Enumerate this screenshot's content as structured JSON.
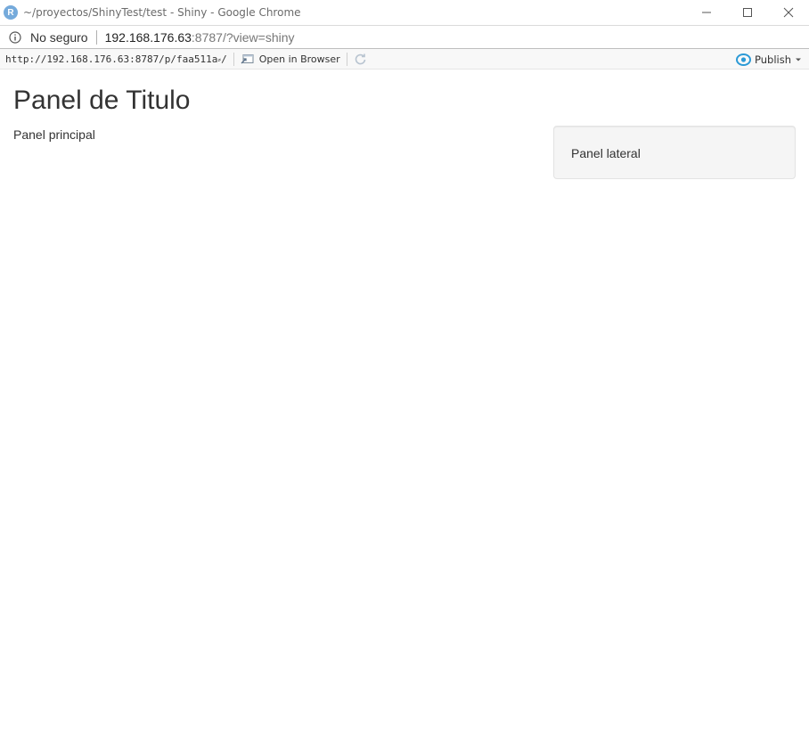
{
  "window": {
    "icon_letter": "R",
    "title": "~/proyectos/ShinyTest/test - Shiny - Google Chrome"
  },
  "address_bar": {
    "security_label": "No seguro",
    "url_host": "192.168.176.63",
    "url_rest": ":8787/?view=shiny"
  },
  "viewer_toolbar": {
    "url": "http://192.168.176.63:8787/p/faa511a⸗/",
    "open_in_browser_label": "Open in Browser",
    "publish_label": "Publish"
  },
  "app": {
    "title": "Panel de Titulo",
    "main_panel_text": "Panel principal",
    "side_panel_text": "Panel lateral"
  },
  "icons": {
    "app": "r-logo-icon",
    "minimize": "minimize-icon",
    "maximize": "maximize-icon",
    "close": "close-icon",
    "info": "info-icon",
    "open_browser": "open-in-browser-icon",
    "refresh": "refresh-icon",
    "publish": "publish-icon",
    "dropdown": "chevron-down-icon"
  },
  "colors": {
    "r_logo": "#75aadb",
    "publish_accent": "#2c9ad6"
  }
}
